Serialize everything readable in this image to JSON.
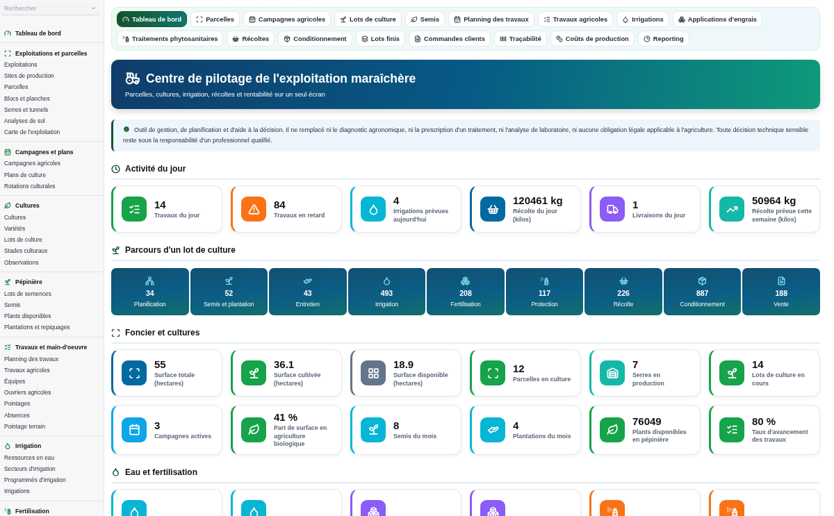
{
  "sidebar": {
    "search": {
      "placeholder": "Rechercher"
    },
    "groups": [
      {
        "title": "Tableau de bord"
      },
      {
        "title": "Exploitations et parcelles",
        "items": [
          "Exploitations",
          "Sites de production",
          "Parcelles",
          "Blocs et planches",
          "Serres et tunnels",
          "Analyses de sol",
          "Carte de l'exploitation"
        ]
      },
      {
        "title": "Campagnes et plans",
        "items": [
          "Campagnes agricoles",
          "Plans de culture",
          "Rotations culturales"
        ]
      },
      {
        "title": "Cultures",
        "items": [
          "Cultures",
          "Variétés",
          "Lots de culture",
          "Stades culturaux",
          "Observations"
        ]
      },
      {
        "title": "Pépinière",
        "items": [
          "Lots de semences",
          "Semis",
          "Plants disponibles",
          "Plantations et repiquages"
        ]
      },
      {
        "title": "Travaux et main-d'oeuvre",
        "items": [
          "Planning des travaux",
          "Travaux agricoles",
          "Équipes",
          "Ouvriers agricoles",
          "Pointages",
          "Absences",
          "Pointage terrain"
        ]
      },
      {
        "title": "Irrigation",
        "items": [
          "Ressources en eau",
          "Secteurs d'irrigation",
          "Programmés d'irrigation",
          "Irrigations"
        ]
      },
      {
        "title": "Fertilisation"
      }
    ]
  },
  "tabs": [
    {
      "label": "Tableau de bord",
      "selected": true
    },
    {
      "label": "Parcelles",
      "selected": false
    },
    {
      "label": "Campagnes agricoles",
      "selected": false
    },
    {
      "label": "Lots de culture",
      "selected": false
    },
    {
      "label": "Semis",
      "selected": false
    },
    {
      "label": "Planning des travaux",
      "selected": false
    },
    {
      "label": "Travaux agricoles",
      "selected": false
    },
    {
      "label": "Irrigations",
      "selected": false
    },
    {
      "label": "Applications d'engrais",
      "selected": false
    },
    {
      "label": "Traitements phytosanitaires",
      "selected": false
    },
    {
      "label": "Récoltes",
      "selected": false
    },
    {
      "label": "Conditionnement",
      "selected": false
    },
    {
      "label": "Lots finis",
      "selected": false
    },
    {
      "label": "Commandes clients",
      "selected": false
    },
    {
      "label": "Traçabilité",
      "selected": false
    },
    {
      "label": "Coûts de production",
      "selected": false
    },
    {
      "label": "Reporting",
      "selected": false
    }
  ],
  "hero": {
    "title": "Centre de pilotage de l'exploitation maraîchère",
    "subtitle": "Parcelles, cultures, irrigation, récoltes et rentabilité sur un seul écran"
  },
  "notice": "Outil de gestion, de planification et d'aide à la décision. Il ne remplacé ni le diagnostic agronomique, ni la prescription d'un traitement, ni l'analyse de laboratoire, ni aucune obligation légale applicable à l'agriculture. Toute décision technique sensible reste sous la responsabilité d'un professionnel qualifié.",
  "activity": {
    "title": "Activité du jour",
    "cards": [
      {
        "value": "14",
        "label": "Travaux du jour",
        "color": "#16a34a"
      },
      {
        "value": "84",
        "label": "Travaux en retard",
        "color": "#f97316"
      },
      {
        "value": "4",
        "label": "Irrigations prévues aujourd'hui",
        "color": "#06b6d4"
      },
      {
        "value": "120461 kg",
        "label": "Récolte du jour (kilos)",
        "color": "#0369a1"
      },
      {
        "value": "1",
        "label": "Livraisons du jour",
        "color": "#8b5cf6"
      },
      {
        "value": "50964 kg",
        "label": "Récolte prévue cette semaine (kilos)",
        "color": "#14b8a6"
      }
    ]
  },
  "pipeline": {
    "title": "Parcours d'un lot de culture",
    "steps": [
      {
        "value": "34",
        "label": "Planification"
      },
      {
        "value": "52",
        "label": "Semis et plantation"
      },
      {
        "value": "43",
        "label": "Entretien"
      },
      {
        "value": "493",
        "label": "Irrigation"
      },
      {
        "value": "208",
        "label": "Fertilisation"
      },
      {
        "value": "117",
        "label": "Protection"
      },
      {
        "value": "226",
        "label": "Récolte"
      },
      {
        "value": "887",
        "label": "Conditionnement"
      },
      {
        "value": "188",
        "label": "Vente"
      }
    ]
  },
  "land": {
    "title": "Foncier et cultures",
    "cards": [
      {
        "value": "55",
        "label": "Surface totale (hectares)",
        "color": "#0369a1"
      },
      {
        "value": "36.1",
        "label": "Surface cultivée (hectares)",
        "color": "#16a34a"
      },
      {
        "value": "18.9",
        "label": "Surface disponible (hectares)",
        "color": "#64748b"
      },
      {
        "value": "12",
        "label": "Parcelles en culture",
        "color": "#16a34a"
      },
      {
        "value": "7",
        "label": "Serres en production",
        "color": "#14b8a6"
      },
      {
        "value": "14",
        "label": "Lots de culture en cours",
        "color": "#16a34a"
      },
      {
        "value": "3",
        "label": "Campagnes actives",
        "color": "#0ea5e9"
      },
      {
        "value": "41 %",
        "label": "Part de surface en agriculture biologique",
        "color": "#16a34a"
      },
      {
        "value": "8",
        "label": "Semis du mois",
        "color": "#06b6d4"
      },
      {
        "value": "4",
        "label": "Plantations du mois",
        "color": "#06b6d4"
      },
      {
        "value": "76049",
        "label": "Plants disponibles en pépinière",
        "color": "#16a34a"
      },
      {
        "value": "80 %",
        "label": "Taux d'avancement des travaux",
        "color": "#16a34a"
      }
    ]
  },
  "water": {
    "title": "Eau et fertilisation",
    "cards": [
      {
        "color": "#06b6d4"
      },
      {
        "color": "#06b6d4"
      },
      {
        "color": "#8b5cf6"
      },
      {
        "color": "#8b5cf6"
      },
      {
        "color": "#f97316"
      },
      {
        "color": "#f97316"
      }
    ]
  }
}
